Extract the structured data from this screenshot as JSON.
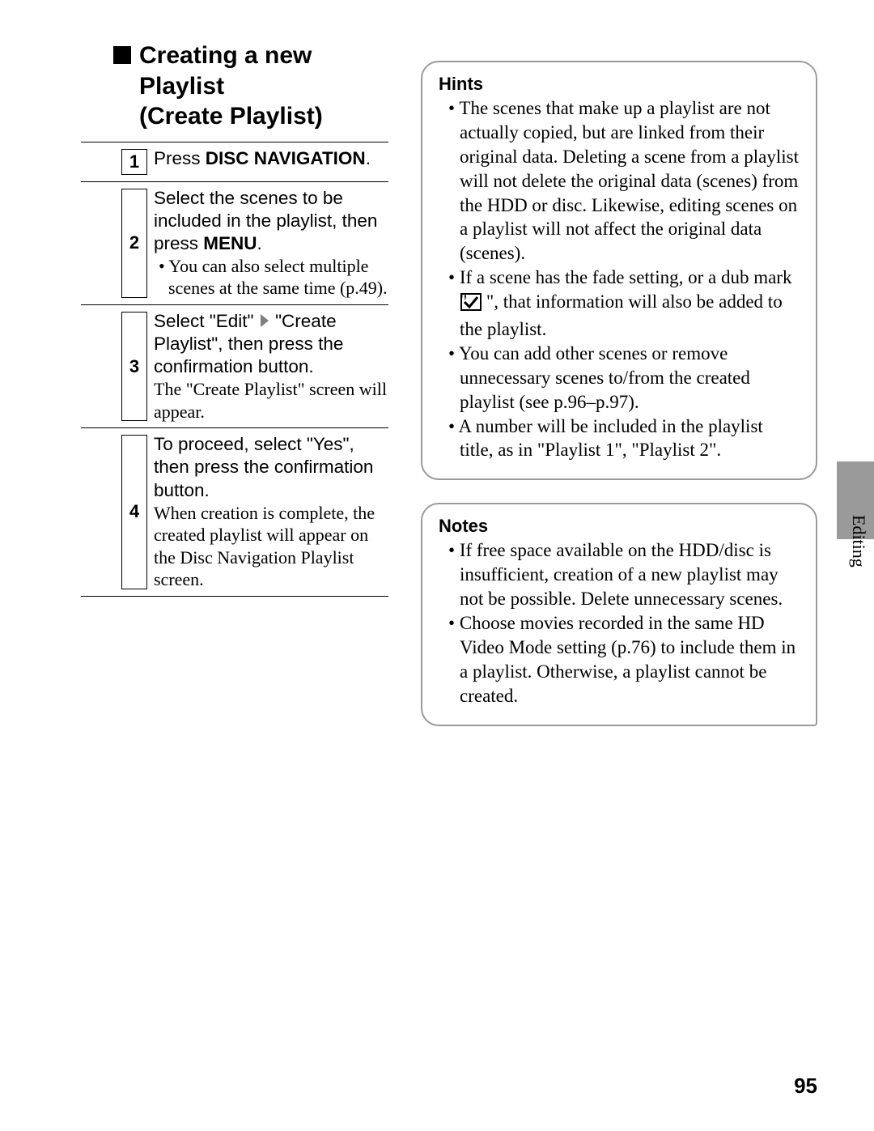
{
  "heading": {
    "line1": "Creating a new",
    "line2": "Playlist",
    "line3": "(Create Playlist)"
  },
  "steps": [
    {
      "num": "1",
      "instruction_pre": "Press ",
      "instruction_bold": "DISC NAVIGATION",
      "instruction_post": "."
    },
    {
      "num": "2",
      "instruction_pre": "Select the scenes to be included in the playlist, then press ",
      "instruction_bold": "MENU",
      "instruction_post": ".",
      "bullet": "You can also select multiple scenes at the same time (p.49)."
    },
    {
      "num": "3",
      "instruction_seg1": "Select \"Edit\" ",
      "instruction_seg2": " \"Create Playlist\", then press the confirmation button.",
      "caption": "The \"Create Playlist\" screen will appear."
    },
    {
      "num": "4",
      "instruction": "To proceed, select \"Yes\", then press the confirmation button.",
      "caption": "When creation is complete, the created playlist will appear on the Disc Navigation Playlist screen."
    }
  ],
  "hints": {
    "title": "Hints",
    "items": [
      "The scenes that make up a playlist are not actually copied, but are linked from their original data. Deleting a scene from a playlist will not delete the original data (scenes) from the HDD or disc. Likewise, editing scenes on a playlist will not affect the original data (scenes).",
      {
        "pre": "If a scene has the fade setting, or a dub mark \" ",
        "post": " \", that information will also be added to the playlist."
      },
      "You can add other scenes or remove unnecessary scenes to/from the created playlist (see p.96–p.97).",
      "A number will be included in the playlist title, as in \"Playlist 1\", \"Playlist 2\"."
    ]
  },
  "notes": {
    "title": "Notes",
    "items": [
      "If free space available on the HDD/disc is insufficient, creation of a new playlist may not be possible. Delete unnecessary scenes.",
      "Choose movies recorded in the same HD Video Mode setting (p.76) to include them in a playlist. Otherwise, a playlist cannot be created."
    ]
  },
  "side_label": "Editing",
  "page_number": "95"
}
